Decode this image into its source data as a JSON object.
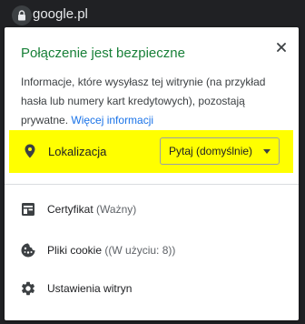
{
  "urlbar": {
    "url": "google.pl",
    "icon": "lock-icon"
  },
  "popup": {
    "title": "Połączenie jest bezpieczne",
    "close_icon": "close-icon",
    "description": "Informacje, które wysyłasz tej witrynie (na przykład hasła lub numery kart kredytowych), pozostają prywatne.",
    "more_info_link": "Więcej informacji",
    "colors": {
      "title": "#188038",
      "link": "#1a73e8",
      "highlight": "#ffff00"
    },
    "location": {
      "icon": "location-pin-icon",
      "label": "Lokalizacja",
      "selected": "Pytaj (domyślnie)"
    },
    "menu": [
      {
        "icon": "certificate-icon",
        "label": "Certyfikat",
        "detail": "(Ważny)"
      },
      {
        "icon": "cookie-icon",
        "label": "Pliki cookie",
        "detail": "((W użyciu: 8))"
      },
      {
        "icon": "gear-icon",
        "label": "Ustawienia witryn",
        "detail": ""
      }
    ]
  }
}
